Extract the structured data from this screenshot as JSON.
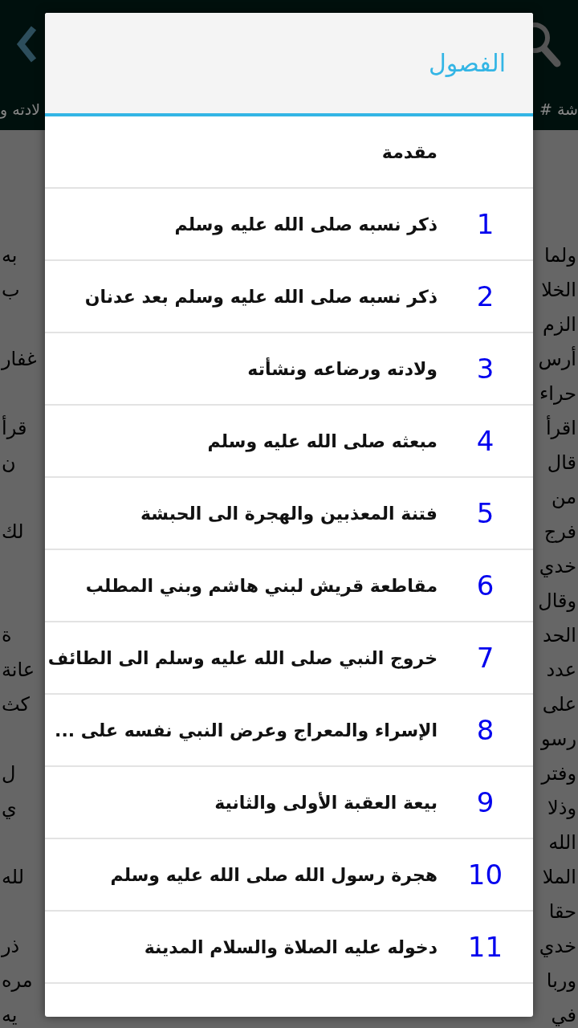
{
  "app_bar": {
    "subtitle_right": "شة #",
    "subtitle_left": "لادته و"
  },
  "background_lines": [
    {
      "right": "ولما",
      "left": "به"
    },
    {
      "right": "الخلا",
      "left": "ب"
    },
    {
      "right": "الزم"
    },
    {
      "right": "أرس",
      "left": "غفار"
    },
    {
      "right": "حراء"
    },
    {
      "right": "اقرأ",
      "left": "قرأ"
    },
    {
      "right": "قال",
      "left": "ن"
    },
    {
      "right": "من"
    },
    {
      "right": "فرج",
      "left": "لك"
    },
    {
      "right": "خدي"
    },
    {
      "right": "وقال"
    },
    {
      "right": "الحد",
      "left": "ة"
    },
    {
      "right": "عدد",
      "left": "عانة"
    },
    {
      "right": "على",
      "left": "كث"
    },
    {
      "right": "رسو"
    },
    {
      "right": "وفتر",
      "left": "ل"
    },
    {
      "right": "وذلا",
      "left": "ي"
    },
    {
      "right": "الله"
    },
    {
      "right": "الملا",
      "left": "لله"
    },
    {
      "right": "حقا"
    },
    {
      "right": "خدي",
      "left": "ذر"
    },
    {
      "right": "وربا",
      "left": "مره"
    },
    {
      "right": "في",
      "left": "يه"
    }
  ],
  "dialog": {
    "title": "الفصول",
    "chapters": [
      {
        "title": "مقدمة"
      },
      {
        "number": "1",
        "title": "ذكر نسبه صلى الله عليه وسلم"
      },
      {
        "number": "2",
        "title": "ذكر نسبه صلى الله عليه وسلم بعد عدنان"
      },
      {
        "number": "3",
        "title": "ولادته ورضاعه ونشأته"
      },
      {
        "number": "4",
        "title": "مبعثه صلى الله عليه وسلم"
      },
      {
        "number": "5",
        "title": "فتنة المعذبين والهجرة الى الحبشة"
      },
      {
        "number": "6",
        "title": "مقاطعة قريش لبني هاشم وبني المطلب"
      },
      {
        "number": "7",
        "title": "خروج النبي صلى الله عليه وسلم الى الطائف"
      },
      {
        "number": "8",
        "title": "الإسراء والمعراج وعرض النبي نفسه على ..."
      },
      {
        "number": "9",
        "title": "بيعة العقبة الأولى والثانية"
      },
      {
        "number": "10",
        "title": "هجرة رسول الله صلى الله عليه وسلم"
      },
      {
        "number": "11",
        "title": "دخوله عليه الصلاة والسلام المدينة"
      }
    ]
  }
}
